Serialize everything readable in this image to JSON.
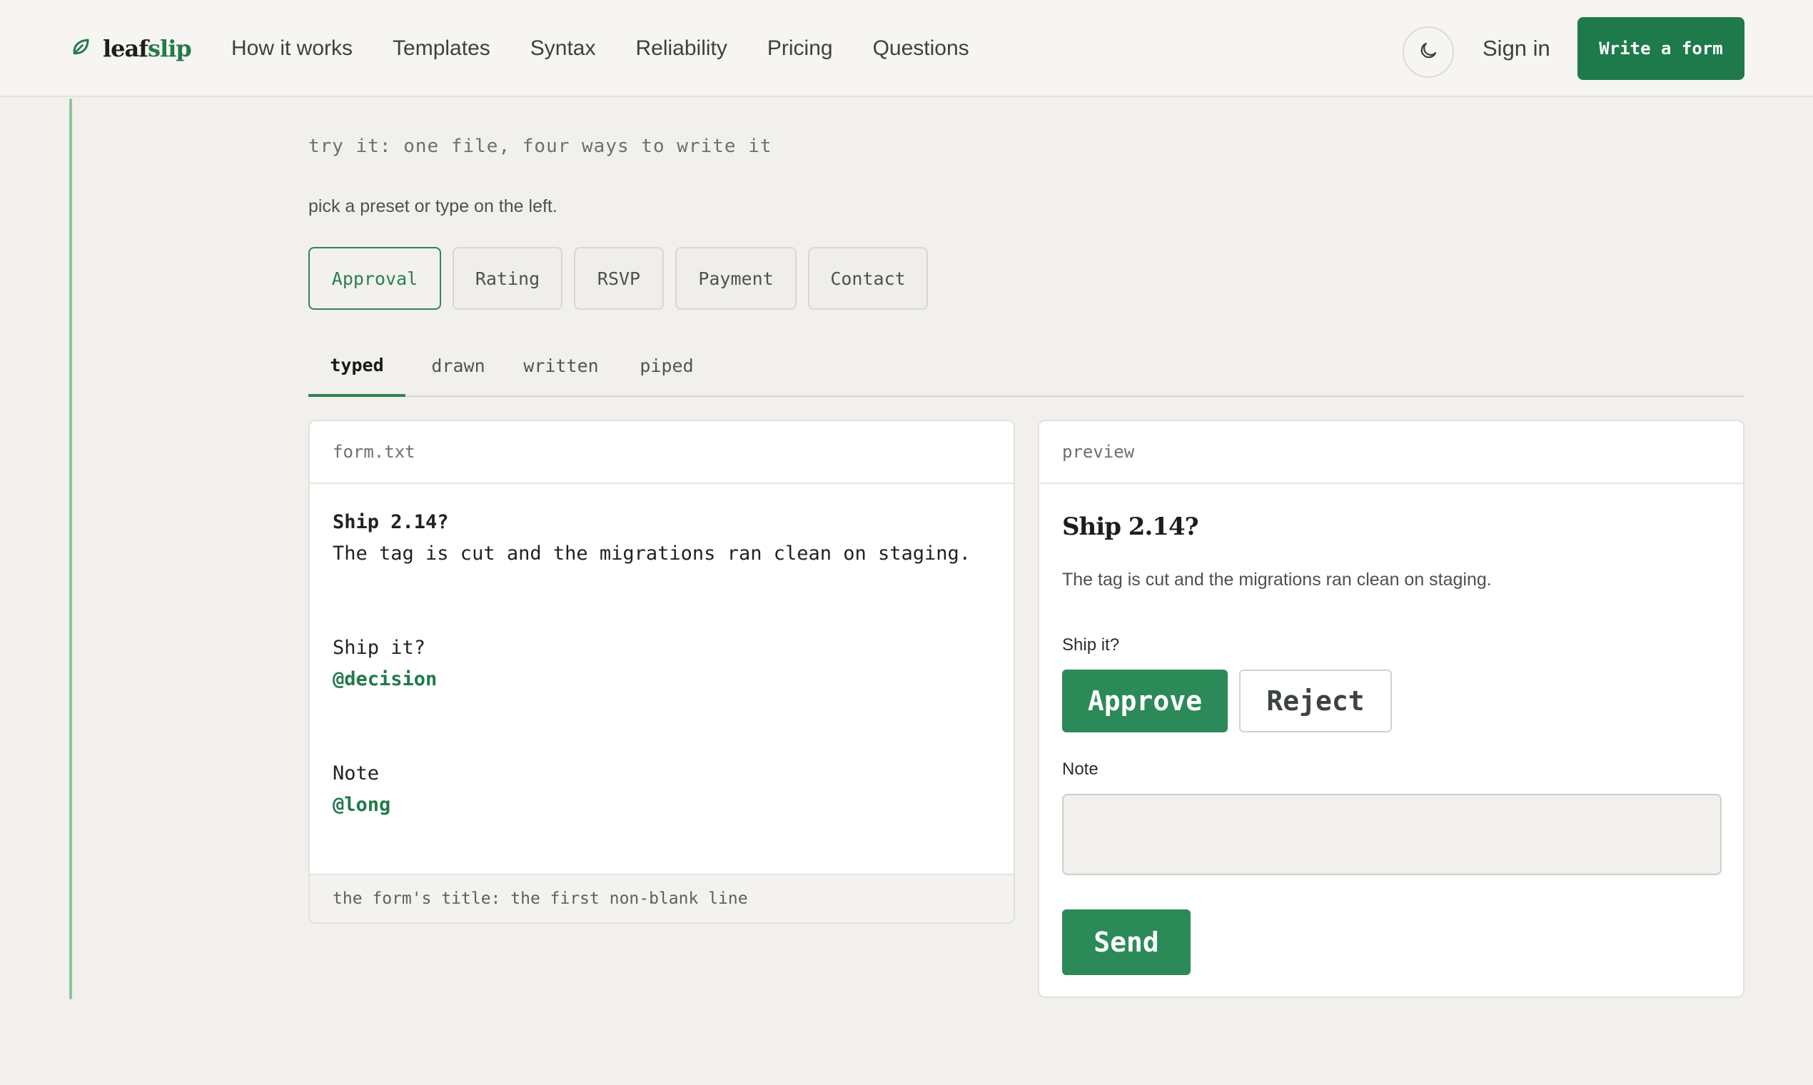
{
  "brand": {
    "name_part1": "leaf",
    "name_part2": "slip",
    "logo_icon": "leaf-icon",
    "accent": "#1f7a4b"
  },
  "nav": {
    "items": [
      "How it works",
      "Templates",
      "Syntax",
      "Reliability",
      "Pricing",
      "Questions"
    ],
    "theme_icon": "moon-icon",
    "sign_in": "Sign in",
    "cta": "Write a form"
  },
  "intro": {
    "heading": "try it: one file, four ways to write it",
    "subtitle": "pick a preset or type on the left."
  },
  "presets": {
    "items": [
      "Approval",
      "Rating",
      "RSVP",
      "Payment",
      "Contact"
    ],
    "selected": "Approval"
  },
  "tabs": {
    "items": [
      "typed",
      "drawn",
      "written",
      "piped"
    ],
    "selected": "typed"
  },
  "editor": {
    "filename": "form.txt",
    "lines": {
      "title": "Ship 2.14?",
      "description": "The tag is cut and the migrations ran clean on staging.",
      "q1": "Ship it?",
      "q1_tag": "@decision",
      "q2": "Note",
      "q2_tag": "@long"
    },
    "hint": "the form's title: the first non-blank line"
  },
  "preview": {
    "header": "preview",
    "title": "Ship 2.14?",
    "description": "The tag is cut and the migrations ran clean on staging.",
    "q1_label": "Ship it?",
    "approve": "Approve",
    "reject": "Reject",
    "note_label": "Note",
    "note_value": "",
    "send": "Send"
  }
}
